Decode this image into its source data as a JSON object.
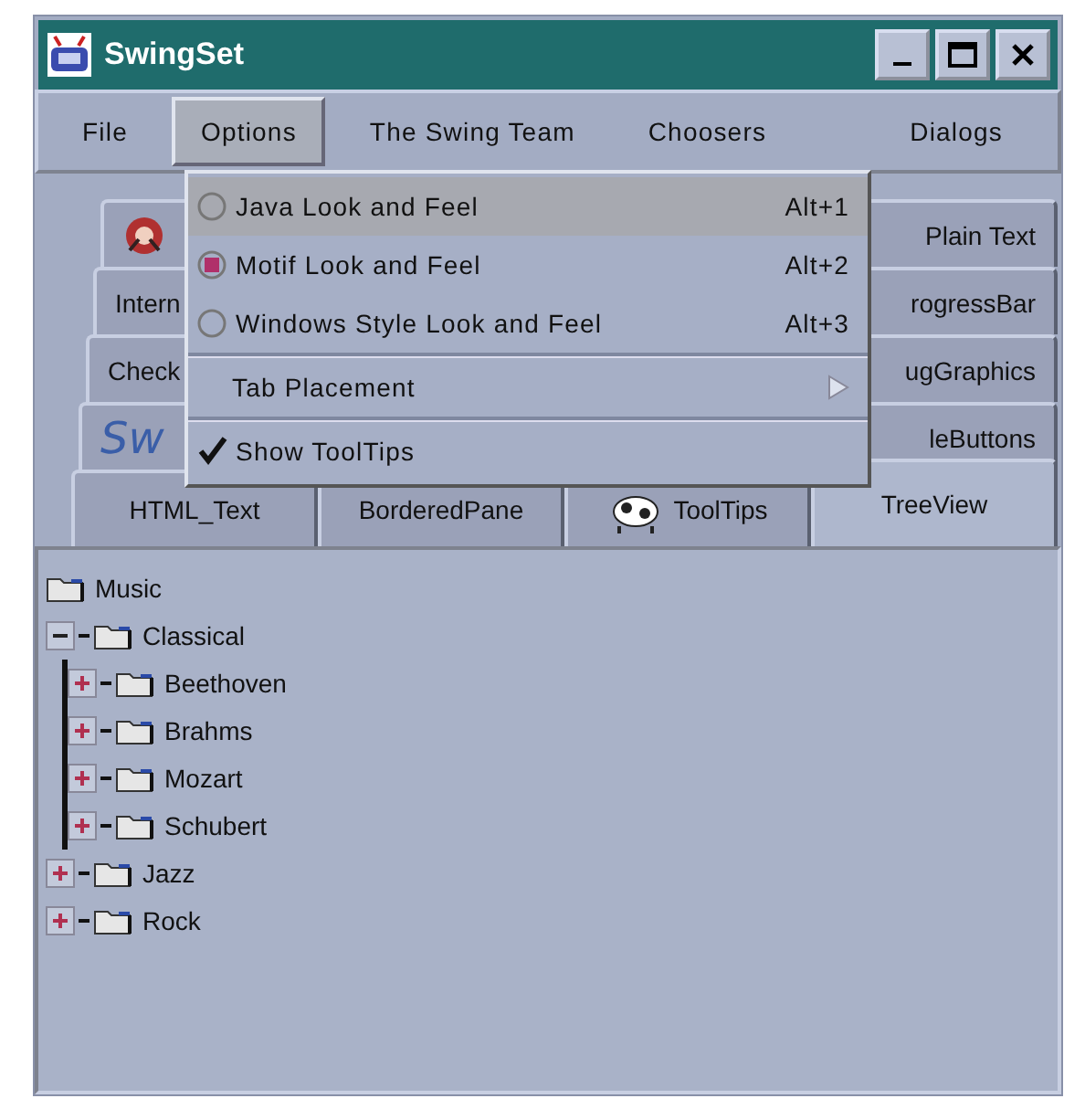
{
  "window": {
    "title": "SwingSet"
  },
  "menu_bar": [
    {
      "label": "File",
      "selected": false
    },
    {
      "label": "Options",
      "selected": true
    },
    {
      "label": "The Swing Team",
      "selected": false
    },
    {
      "label": "Choosers",
      "selected": false
    },
    {
      "label": "Dialogs",
      "selected": false
    }
  ],
  "tab_rows": [
    {
      "tabs": [
        {
          "kind": "icon",
          "selected": false
        },
        {
          "kind": "text",
          "label": "Plain Text",
          "selected": false
        }
      ]
    },
    {
      "tabs": [
        {
          "kind": "text",
          "label": "Intern",
          "selected": false
        },
        {
          "kind": "text",
          "label": "rogressBar",
          "selected": false
        }
      ]
    },
    {
      "tabs": [
        {
          "kind": "text",
          "label": "Check",
          "selected": false
        },
        {
          "kind": "text",
          "label": "ugGraphics",
          "selected": false
        }
      ]
    },
    {
      "tabs": [
        {
          "kind": "logo",
          "label": "Sw",
          "selected": false
        },
        {
          "kind": "text",
          "label": "leButtons",
          "selected": false
        }
      ]
    },
    {
      "tabs": [
        {
          "kind": "text",
          "label": "HTML_Text",
          "selected": false
        },
        {
          "kind": "text",
          "label": "BorderedPane",
          "selected": false
        },
        {
          "kind": "icon_text",
          "label": "ToolTips",
          "selected": false
        },
        {
          "kind": "text",
          "label": "TreeView",
          "selected": true
        }
      ]
    }
  ],
  "options_menu": [
    {
      "kind": "radio",
      "label": "Java Look and Feel",
      "shortcut": "Alt+1",
      "checked": false,
      "highlighted": true
    },
    {
      "kind": "radio",
      "label": "Motif Look and Feel",
      "shortcut": "Alt+2",
      "checked": true,
      "highlighted": false
    },
    {
      "kind": "radio",
      "label": "Windows Style Look and Feel",
      "shortcut": "Alt+3",
      "checked": false,
      "highlighted": false
    },
    {
      "kind": "submenu",
      "label": "Tab Placement",
      "highlighted": false
    },
    {
      "kind": "check",
      "label": "Show ToolTips",
      "checked": true,
      "highlighted": false
    }
  ],
  "tree": {
    "label": "Music",
    "children": [
      {
        "label": "Classical",
        "expanded": true,
        "children": [
          {
            "label": "Beethoven",
            "expanded": false
          },
          {
            "label": "Brahms",
            "expanded": false
          },
          {
            "label": "Mozart",
            "expanded": false
          },
          {
            "label": "Schubert",
            "expanded": false
          }
        ]
      },
      {
        "label": "Jazz",
        "expanded": false
      },
      {
        "label": "Rock",
        "expanded": false
      }
    ]
  }
}
